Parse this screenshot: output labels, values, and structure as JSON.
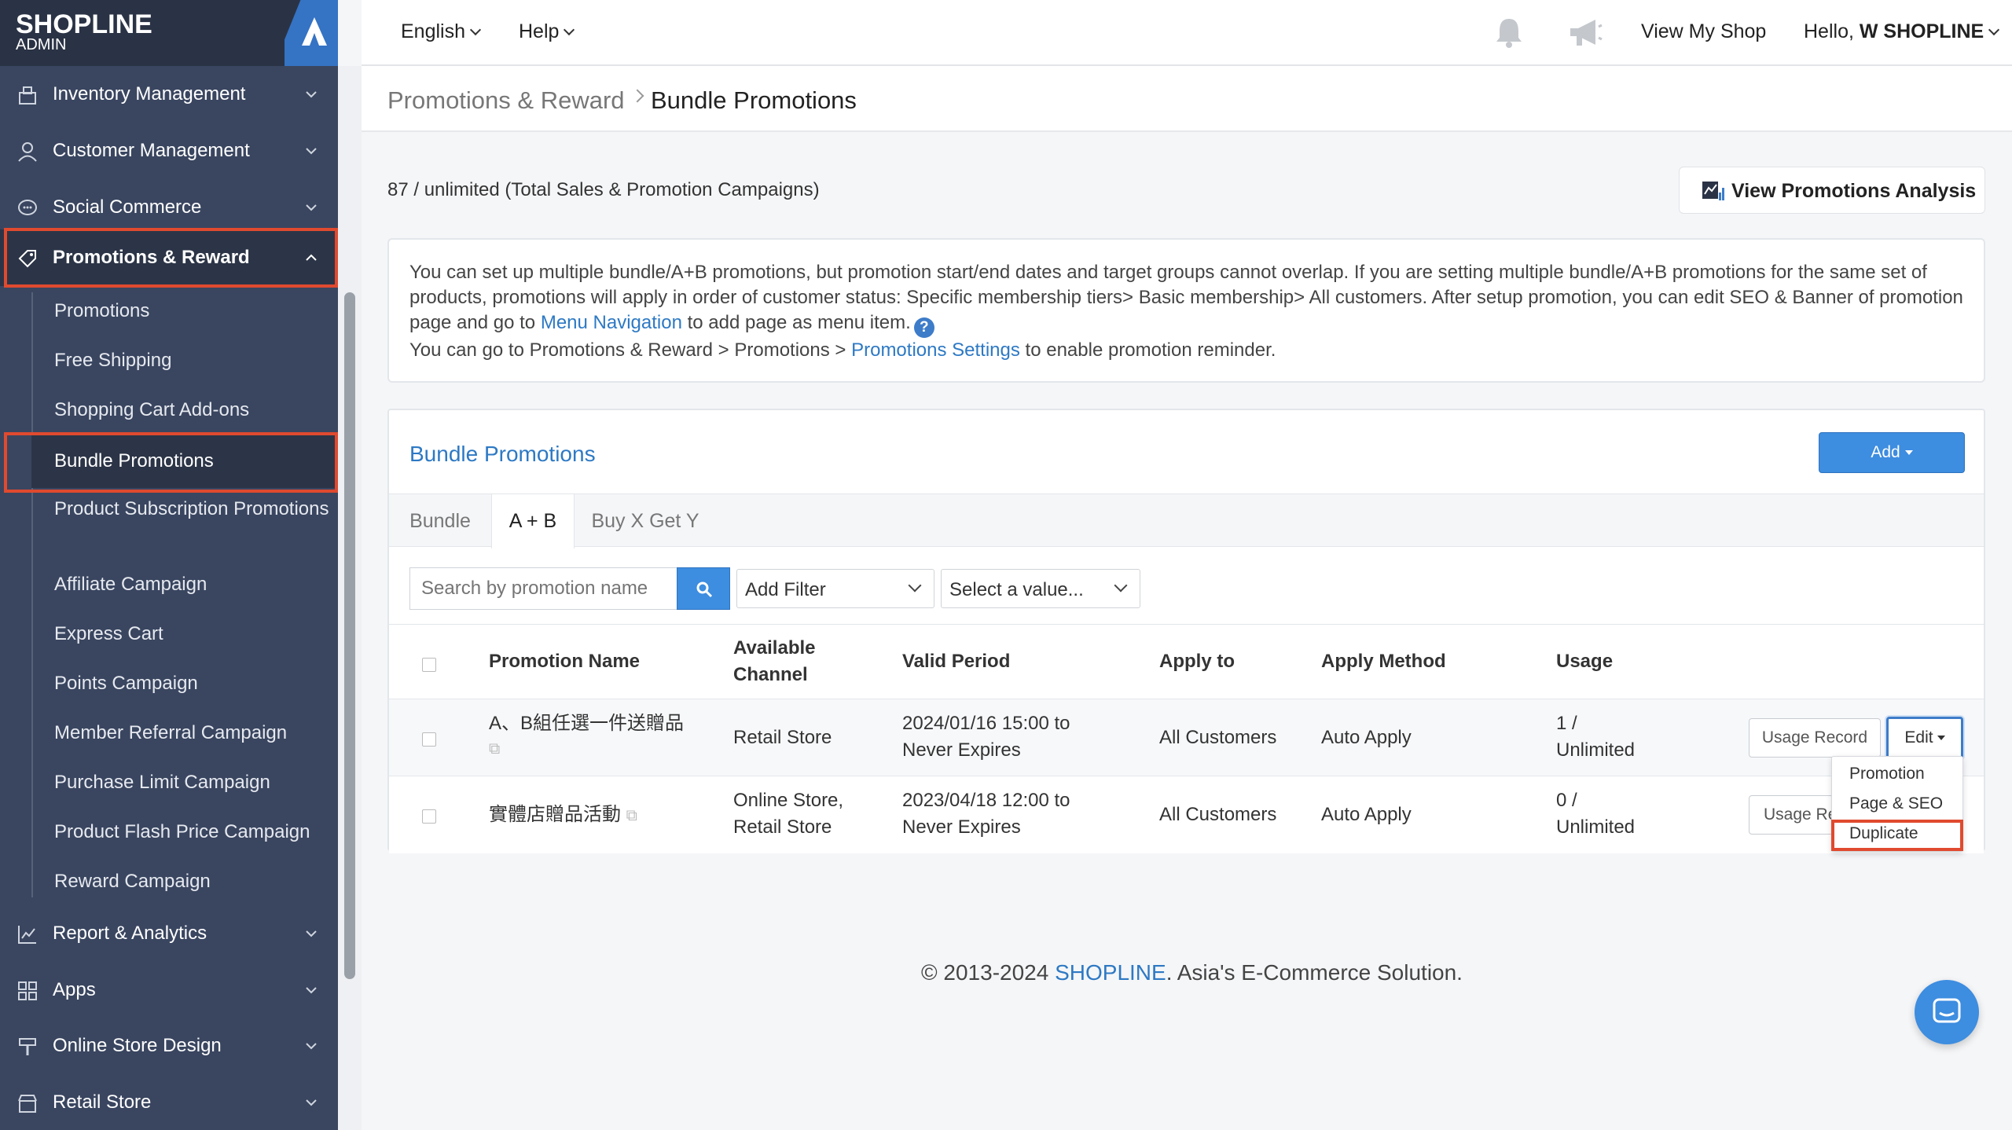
{
  "brand": {
    "logo": "SHOPLINE",
    "sub": "ADMIN"
  },
  "colors": {
    "sidebar": "#3a4660",
    "accent": "#3d8de0",
    "link": "#2d79c4",
    "highlight": "#e04a2f"
  },
  "sidebar": {
    "groups_top": [
      {
        "label": "Inventory Management",
        "icon": "inventory-icon"
      },
      {
        "label": "Customer Management",
        "icon": "user-icon"
      },
      {
        "label": "Social Commerce",
        "icon": "chat-icon"
      },
      {
        "label": "Promotions & Reward",
        "icon": "tag-icon"
      }
    ],
    "sub_items": [
      {
        "label": "Promotions"
      },
      {
        "label": "Free Shipping"
      },
      {
        "label": "Shopping Cart Add-ons"
      },
      {
        "label": "Bundle Promotions"
      },
      {
        "label": "Product Subscription Promotions"
      },
      {
        "label": "Affiliate Campaign"
      },
      {
        "label": "Express Cart"
      },
      {
        "label": "Points Campaign"
      },
      {
        "label": "Member Referral Campaign"
      },
      {
        "label": "Purchase Limit Campaign"
      },
      {
        "label": "Product Flash Price Campaign"
      },
      {
        "label": "Reward Campaign"
      }
    ],
    "groups_bottom": [
      {
        "label": "Report & Analytics",
        "icon": "chart-icon"
      },
      {
        "label": "Apps",
        "icon": "apps-icon"
      },
      {
        "label": "Online Store Design",
        "icon": "brush-icon"
      },
      {
        "label": "Retail Store",
        "icon": "store-icon"
      }
    ]
  },
  "topbar": {
    "language": "English",
    "help": "Help",
    "view_shop": "View My Shop",
    "hello": "Hello,",
    "user": "W SHOPLINE"
  },
  "breadcrumb": {
    "parent": "Promotions & Reward",
    "current": "Bundle Promotions"
  },
  "quota": "87 / unlimited (Total Sales & Promotion Campaigns)",
  "analysis_button": "View Promotions Analysis",
  "notice": {
    "line1a": "You can set up multiple bundle/A+B promotions, but promotion start/end dates and target groups cannot overlap. If you are setting multiple bundle/A+B promotions for the same set of products, promotions will apply in order of customer status: Specific membership tiers> Basic membership> All customers. After setup promotion, you can edit SEO & Banner of promotion page and go to ",
    "link1": "Menu Navigation",
    "line1b": " to add page as menu item.",
    "line2a": "You can go to Promotions & Reward > Promotions > ",
    "link2": "Promotions Settings",
    "line2b": " to enable promotion reminder."
  },
  "panel": {
    "title": "Bundle Promotions",
    "add_label": "Add",
    "tabs": [
      "Bundle",
      "A + B",
      "Buy X Get Y"
    ],
    "search_placeholder": "Search by promotion name",
    "filter": "Add Filter",
    "value": "Select a value...",
    "columns": {
      "name": "Promotion Name",
      "channel_a": "Available",
      "channel_b": "Channel",
      "period": "Valid Period",
      "apply_to": "Apply to",
      "method": "Apply Method",
      "usage": "Usage"
    },
    "rows": [
      {
        "name": "A、B組任選一件送贈品",
        "channel_a": "Retail Store",
        "channel_b": "",
        "period_a": "2024/01/16 15:00 to",
        "period_b": "Never Expires",
        "apply_to": "All Customers",
        "method": "Auto Apply",
        "usage_a": "1 /",
        "usage_b": "Unlimited",
        "usage_btn": "Usage Record",
        "edit_btn": "Edit"
      },
      {
        "name": "實體店贈品活動",
        "channel_a": "Online Store,",
        "channel_b": "Retail Store",
        "period_a": "2023/04/18 12:00 to",
        "period_b": "Never Expires",
        "apply_to": "All Customers",
        "method": "Auto Apply",
        "usage_a": "0 /",
        "usage_b": "Unlimited",
        "usage_btn": "Usage Re"
      }
    ],
    "dropdown": [
      "Promotion",
      "Page & SEO",
      "Duplicate"
    ]
  },
  "footer": {
    "pre": "© 2013-2024 ",
    "brand": "SHOPLINE",
    "post": ". Asia's E-Commerce Solution."
  }
}
